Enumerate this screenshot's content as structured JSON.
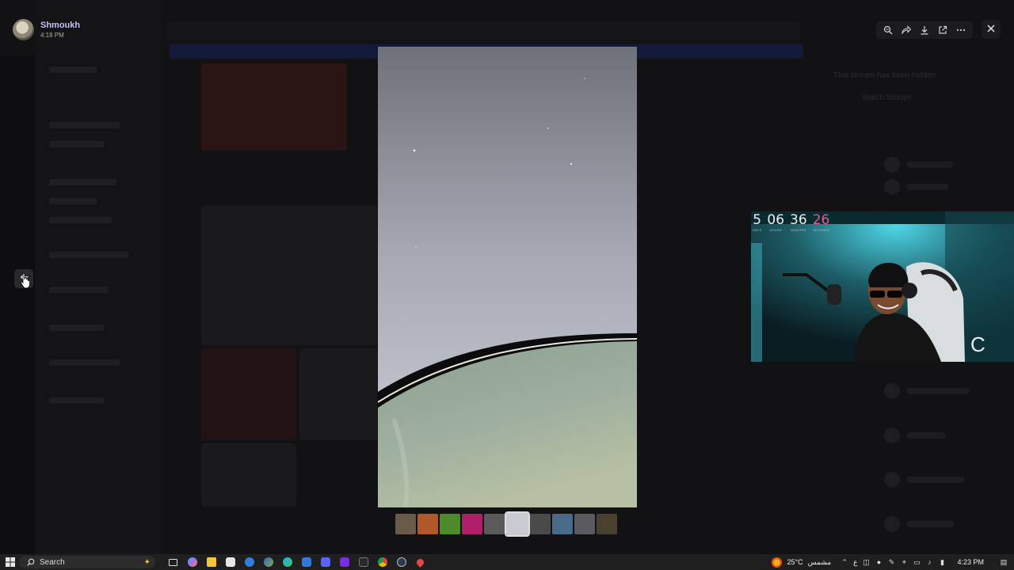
{
  "viewer": {
    "uploader_name": "Shmoukh",
    "upload_time": "4:18 PM"
  },
  "background": {
    "server_name": "Shmoukh Online Server",
    "stream_hidden_text": "This stream has been hidden.",
    "watch_stream_text": "Watch Stream"
  },
  "toolbar": {
    "icons": [
      "zoom-icon",
      "forward-icon",
      "download-icon",
      "open-original-icon",
      "more-icon"
    ],
    "close_icon": "close-icon"
  },
  "thumbnails": {
    "count": 10,
    "active_index": 5,
    "colors": [
      "#6a5a4a",
      "#b0582a",
      "#4d8a2a",
      "#b0206a",
      "#5a5a5a",
      "#c8cbd2",
      "#4a4a4a",
      "#4a6a8a",
      "#5a5a60",
      "#4a4030"
    ]
  },
  "webcam": {
    "timer": [
      {
        "value": "5",
        "label": "DAYS"
      },
      {
        "value": "06",
        "label": "HOURS"
      },
      {
        "value": "36",
        "label": "MINUTES"
      },
      {
        "value": "26",
        "label": "SECONDS"
      }
    ],
    "timer_accent": "#e35a8a"
  },
  "taskbar": {
    "search_label": "Search",
    "weather_temp": "25°C",
    "weather_desc": "مشمس",
    "language": "ع",
    "clock": "4:23 PM"
  },
  "colors": {
    "accent": "#bfc3f5",
    "backdrop": "#0b0b0c"
  }
}
